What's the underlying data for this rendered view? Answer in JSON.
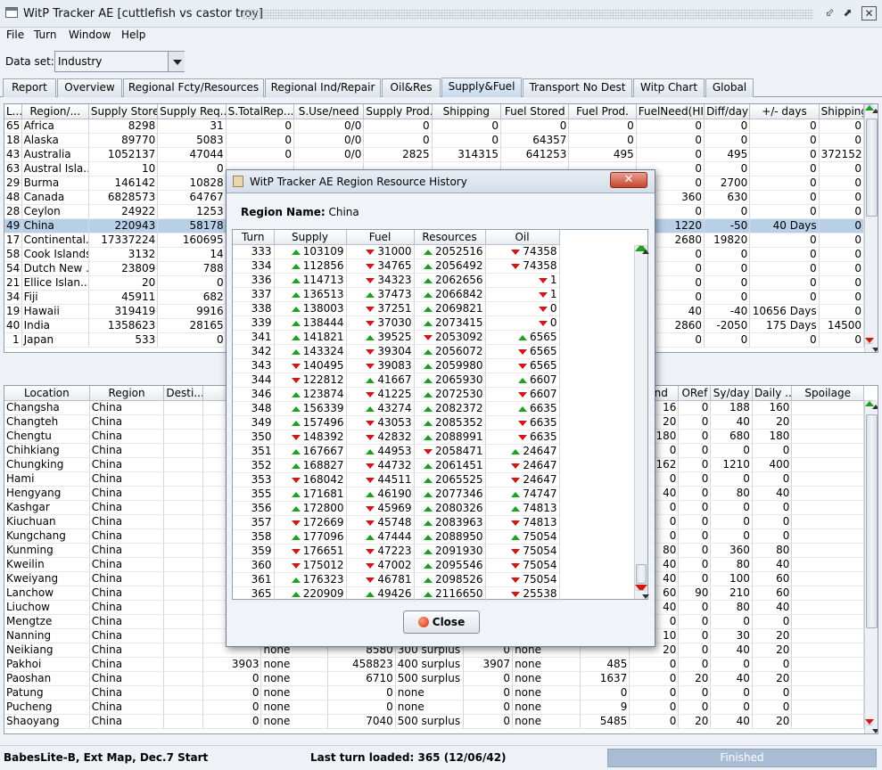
{
  "window": {
    "title": "WitP Tracker AE [cuttlefish vs castor troy]",
    "minimize": "⬃",
    "maximize": "⬈",
    "close": "✕"
  },
  "menu": [
    "File",
    "Turn",
    "Window",
    "Help"
  ],
  "dataset": {
    "label": "Data set:",
    "value": "Industry"
  },
  "tabs": [
    "Report",
    "Overview",
    "Regional Fcty/Resources",
    "Regional Ind/Repair",
    "Oil&Res",
    "Supply&Fuel",
    "Transport No Dest",
    "Witp Chart",
    "Global"
  ],
  "active_tab": "Supply&Fuel",
  "top_table": {
    "headers": [
      "L...",
      "Region/...",
      "Supply Stored",
      "Supply Req...",
      "S.TotalRep...",
      "S.Use/need",
      "Supply Prod.",
      "Shipping",
      "Fuel Stored",
      "Fuel Prod.",
      "FuelNeed(HI)",
      "Diff/day",
      "+/- days",
      "Shipping"
    ],
    "rows": [
      [
        "65",
        "Africa",
        "8298",
        "31",
        "0",
        "0/0",
        "0",
        "0",
        "0",
        "0",
        "0",
        "0",
        "0",
        "0"
      ],
      [
        "18",
        "Alaska",
        "89770",
        "5083",
        "0",
        "0/0",
        "0",
        "0",
        "64357",
        "0",
        "0",
        "0",
        "0",
        "0"
      ],
      [
        "43",
        "Australia",
        "1052137",
        "47044",
        "0",
        "0/0",
        "2825",
        "314315",
        "641253",
        "495",
        "0",
        "495",
        "0",
        "372152"
      ],
      [
        "63",
        "Austral Isla...",
        "10",
        "0",
        "",
        "",
        "",
        "",
        "",
        "",
        "0",
        "0",
        "0",
        "0"
      ],
      [
        "29",
        "Burma",
        "146142",
        "10828",
        "",
        "",
        "",
        "",
        "",
        "",
        "0",
        "2700",
        "0",
        "0"
      ],
      [
        "48",
        "Canada",
        "6828573",
        "64767",
        "",
        "",
        "",
        "",
        "",
        "",
        "360",
        "630",
        "0",
        "0"
      ],
      [
        "28",
        "Ceylon",
        "24922",
        "1253",
        "",
        "",
        "",
        "",
        "",
        "",
        "0",
        "0",
        "0",
        "0"
      ],
      [
        "49",
        "China",
        "220943",
        "58178",
        "",
        "",
        "",
        "",
        "",
        "",
        "1220",
        "-50",
        "40 Days",
        "0"
      ],
      [
        "17",
        "Continental...",
        "17337224",
        "160695",
        "",
        "",
        "",
        "",
        "",
        "",
        "2680",
        "19820",
        "0",
        "0"
      ],
      [
        "58",
        "Cook Islands",
        "3132",
        "14",
        "",
        "",
        "",
        "",
        "",
        "",
        "0",
        "0",
        "0",
        "0"
      ],
      [
        "54",
        "Dutch New ...",
        "23809",
        "788",
        "",
        "",
        "",
        "",
        "",
        "",
        "0",
        "0",
        "0",
        "0"
      ],
      [
        "21",
        "Ellice Islan...",
        "20",
        "0",
        "",
        "",
        "",
        "",
        "",
        "",
        "0",
        "0",
        "0",
        "0"
      ],
      [
        "34",
        "Fiji",
        "45911",
        "682",
        "",
        "",
        "",
        "",
        "",
        "",
        "0",
        "0",
        "0",
        "0"
      ],
      [
        "19",
        "Hawaii",
        "319419",
        "9916",
        "",
        "",
        "",
        "",
        "",
        "",
        "40",
        "-40",
        "10656 Days",
        "0"
      ],
      [
        "40",
        "India",
        "1358623",
        "28165",
        "",
        "",
        "",
        "",
        "",
        "",
        "2860",
        "-2050",
        "175 Days",
        "14500"
      ],
      [
        "1",
        "Japan",
        "533",
        "0",
        "",
        "",
        "",
        "",
        "",
        "",
        "0",
        "0",
        "0",
        "0"
      ]
    ]
  },
  "bottom_table": {
    "headers": [
      "Location",
      "Region",
      "Desti...",
      "Oi",
      "",
      "",
      "",
      "",
      "",
      "",
      "htInd",
      "ORef",
      "Sy/day",
      "Daily ...",
      "Spoilage"
    ],
    "rows": [
      [
        "Changsha",
        "China",
        "",
        "",
        "",
        "",
        "",
        "",
        "",
        "",
        "16",
        "0",
        "188",
        "160",
        ""
      ],
      [
        "Changteh",
        "China",
        "",
        "",
        "",
        "",
        "",
        "",
        "",
        "",
        "20",
        "0",
        "40",
        "20",
        ""
      ],
      [
        "Chengtu",
        "China",
        "",
        "",
        "",
        "",
        "",
        "",
        "",
        "",
        "180",
        "0",
        "680",
        "180",
        ""
      ],
      [
        "Chihkiang",
        "China",
        "",
        "",
        "",
        "",
        "",
        "",
        "",
        "",
        "0",
        "0",
        "0",
        "0",
        ""
      ],
      [
        "Chungking",
        "China",
        "",
        "",
        "",
        "",
        "",
        "",
        "",
        "",
        "162",
        "0",
        "1210",
        "400",
        ""
      ],
      [
        "Hami",
        "China",
        "",
        "",
        "",
        "",
        "",
        "",
        "",
        "",
        "0",
        "0",
        "0",
        "0",
        ""
      ],
      [
        "Hengyang",
        "China",
        "",
        "",
        "",
        "",
        "",
        "",
        "",
        "",
        "40",
        "0",
        "80",
        "40",
        ""
      ],
      [
        "Kashgar",
        "China",
        "",
        "",
        "",
        "",
        "",
        "",
        "",
        "",
        "0",
        "0",
        "0",
        "0",
        ""
      ],
      [
        "Kiuchuan",
        "China",
        "",
        "",
        "",
        "",
        "",
        "",
        "",
        "",
        "0",
        "0",
        "0",
        "0",
        ""
      ],
      [
        "Kungchang",
        "China",
        "",
        "",
        "",
        "",
        "",
        "",
        "",
        "",
        "0",
        "0",
        "0",
        "0",
        ""
      ],
      [
        "Kunming",
        "China",
        "",
        "",
        "",
        "",
        "",
        "",
        "",
        "",
        "80",
        "0",
        "360",
        "80",
        ""
      ],
      [
        "Kweilin",
        "China",
        "",
        "",
        "",
        "",
        "",
        "",
        "",
        "",
        "40",
        "0",
        "80",
        "40",
        ""
      ],
      [
        "Kweiyang",
        "China",
        "",
        "",
        "",
        "",
        "",
        "",
        "",
        "",
        "40",
        "0",
        "100",
        "60",
        ""
      ],
      [
        "Lanchow",
        "China",
        "",
        "17",
        "",
        "",
        "",
        "",
        "",
        "",
        "60",
        "90",
        "210",
        "60",
        ""
      ],
      [
        "Liuchow",
        "China",
        "",
        "",
        "",
        "",
        "",
        "",
        "",
        "",
        "40",
        "0",
        "80",
        "40",
        ""
      ],
      [
        "Mengtze",
        "China",
        "",
        "",
        "",
        "",
        "",
        "",
        "",
        "",
        "0",
        "0",
        "0",
        "0",
        ""
      ],
      [
        "Nanning",
        "China",
        "",
        "",
        "",
        "",
        "",
        "",
        "",
        "",
        "10",
        "0",
        "30",
        "20",
        ""
      ],
      [
        "Neikiang",
        "China",
        "",
        "",
        "none",
        "8580",
        "300 surplus",
        "0",
        "none",
        "",
        "20",
        "0",
        "40",
        "20",
        ""
      ],
      [
        "Pakhoi",
        "China",
        "",
        "3903",
        "none",
        "458823",
        "400 surplus",
        "3907",
        "none",
        "485",
        "0",
        "0",
        "0",
        "0",
        ""
      ],
      [
        "Paoshan",
        "China",
        "",
        "0",
        "none",
        "6710",
        "500 surplus",
        "0",
        "none",
        "1637",
        "0",
        "20",
        "40",
        "20",
        ""
      ],
      [
        "Patung",
        "China",
        "",
        "0",
        "none",
        "0",
        "none",
        "0",
        "none",
        "0",
        "0",
        "0",
        "0",
        "0",
        ""
      ],
      [
        "Pucheng",
        "China",
        "",
        "0",
        "none",
        "0",
        "none",
        "0",
        "none",
        "9",
        "0",
        "0",
        "0",
        "0",
        ""
      ],
      [
        "Shaoyang",
        "China",
        "",
        "0",
        "none",
        "7040",
        "500 surplus",
        "0",
        "none",
        "5485",
        "0",
        "20",
        "40",
        "20",
        ""
      ]
    ]
  },
  "dialog": {
    "title": "WitP Tracker AE Region Resource History",
    "region_label": "Region Name:",
    "region_name": "China",
    "headers": [
      "Turn",
      "Supply",
      "Fuel",
      "Resources",
      "Oil"
    ],
    "rows": [
      [
        "333",
        "up",
        "103109",
        "dn",
        "31000",
        "up",
        "2052516",
        "dn",
        "74358"
      ],
      [
        "334",
        "up",
        "112856",
        "dn",
        "34765",
        "up",
        "2056492",
        "dn",
        "74358"
      ],
      [
        "336",
        "up",
        "114713",
        "dn",
        "34323",
        "up",
        "2062656",
        "dn",
        "1"
      ],
      [
        "337",
        "up",
        "136513",
        "up",
        "37473",
        "up",
        "2066842",
        "dn",
        "1"
      ],
      [
        "338",
        "up",
        "138003",
        "dn",
        "37251",
        "up",
        "2069821",
        "dn",
        "0"
      ],
      [
        "339",
        "up",
        "138444",
        "dn",
        "37030",
        "up",
        "2073415",
        "dn",
        "0"
      ],
      [
        "341",
        "up",
        "141821",
        "up",
        "39525",
        "dn",
        "2053092",
        "up",
        "6565"
      ],
      [
        "342",
        "up",
        "143324",
        "dn",
        "39304",
        "up",
        "2056072",
        "dn",
        "6565"
      ],
      [
        "343",
        "dn",
        "140495",
        "dn",
        "39083",
        "up",
        "2059980",
        "dn",
        "6565"
      ],
      [
        "344",
        "dn",
        "122812",
        "up",
        "41667",
        "up",
        "2065930",
        "up",
        "6607"
      ],
      [
        "346",
        "up",
        "123874",
        "dn",
        "41225",
        "up",
        "2072530",
        "dn",
        "6607"
      ],
      [
        "348",
        "up",
        "156339",
        "up",
        "43274",
        "up",
        "2082372",
        "up",
        "6635"
      ],
      [
        "349",
        "up",
        "157496",
        "dn",
        "43053",
        "up",
        "2085352",
        "dn",
        "6635"
      ],
      [
        "350",
        "dn",
        "148392",
        "dn",
        "42832",
        "up",
        "2088991",
        "dn",
        "6635"
      ],
      [
        "351",
        "up",
        "167667",
        "up",
        "44953",
        "dn",
        "2058471",
        "up",
        "24647"
      ],
      [
        "352",
        "up",
        "168827",
        "dn",
        "44732",
        "up",
        "2061451",
        "dn",
        "24647"
      ],
      [
        "353",
        "dn",
        "168042",
        "dn",
        "44511",
        "up",
        "2065525",
        "dn",
        "24647"
      ],
      [
        "355",
        "up",
        "171681",
        "up",
        "46190",
        "up",
        "2077346",
        "up",
        "74747"
      ],
      [
        "356",
        "up",
        "172800",
        "dn",
        "45969",
        "up",
        "2080326",
        "up",
        "74813"
      ],
      [
        "357",
        "dn",
        "172669",
        "dn",
        "45748",
        "up",
        "2083963",
        "dn",
        "74813"
      ],
      [
        "358",
        "up",
        "177096",
        "up",
        "47444",
        "up",
        "2088950",
        "up",
        "75054"
      ],
      [
        "359",
        "dn",
        "176651",
        "dn",
        "47223",
        "up",
        "2091930",
        "dn",
        "75054"
      ],
      [
        "360",
        "dn",
        "175012",
        "dn",
        "47002",
        "up",
        "2095546",
        "dn",
        "75054"
      ],
      [
        "361",
        "up",
        "176323",
        "dn",
        "46781",
        "up",
        "2098526",
        "dn",
        "75054"
      ],
      [
        "365",
        "up",
        "220909",
        "up",
        "49426",
        "up",
        "2116650",
        "dn",
        "25538"
      ]
    ],
    "close_label": "Close"
  },
  "status": {
    "left": "BabesLite-B, Ext Map, Dec.7 Start",
    "center": "Last turn loaded: 365 (12/06/42)",
    "right": "Finished"
  },
  "colors": {
    "up": "#1fa01f",
    "down": "#d01818",
    "selected_row": "#b8cfe8",
    "active_tab": "#c8d9ec"
  }
}
